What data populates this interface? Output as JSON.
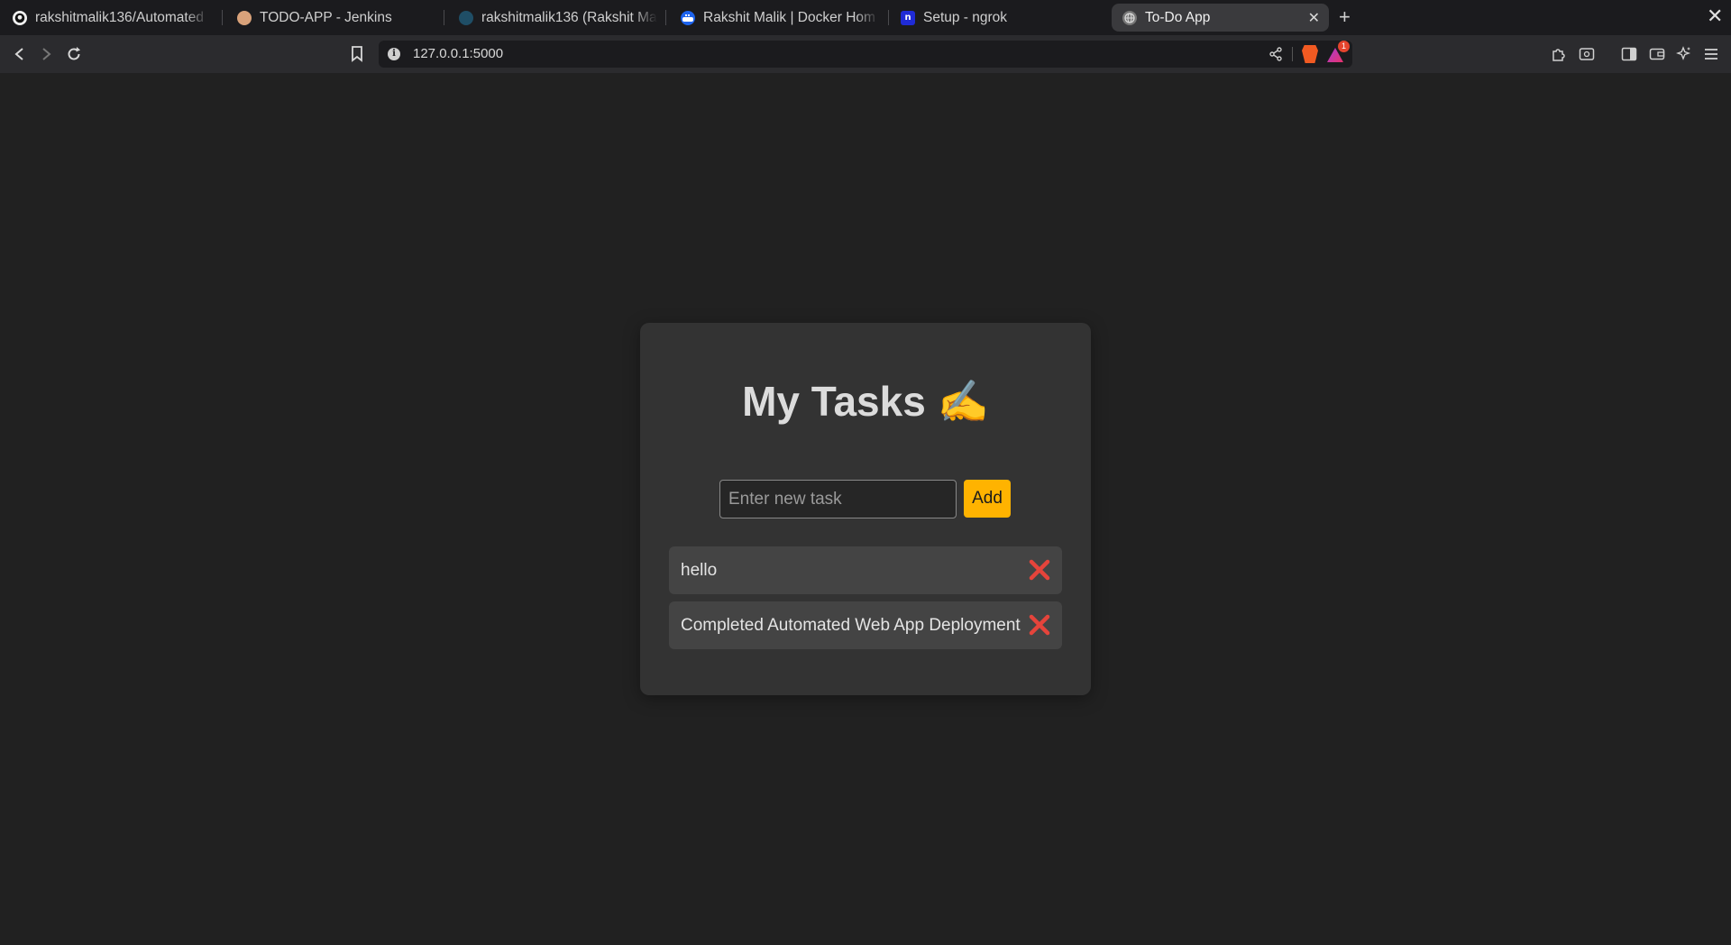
{
  "browser": {
    "tabs": [
      {
        "title": "rakshitmalik136/Automated",
        "icon": "github-icon",
        "active": false
      },
      {
        "title": "TODO-APP - Jenkins",
        "icon": "jenkins-icon",
        "active": false
      },
      {
        "title": "rakshitmalik136 (Rakshit Ma",
        "icon": "docker-hub-icon",
        "active": false
      },
      {
        "title": "Rakshit Malik | Docker Hom",
        "icon": "docker-icon",
        "active": false
      },
      {
        "title": "Setup - ngrok",
        "icon": "ngrok-icon",
        "active": false
      },
      {
        "title": "To-Do App",
        "icon": "globe-icon",
        "active": true
      }
    ],
    "close_tab_glyph": "✕",
    "new_tab_glyph": "+",
    "window_close_glyph": "✕",
    "address": "127.0.0.1:5000",
    "notification_count": "1",
    "accent_colors": {
      "brave": "#f15a22",
      "add_button": "#ffb300",
      "delete": "#e5443b"
    }
  },
  "app": {
    "title": "My Tasks ✍️",
    "input_placeholder": "Enter new task",
    "input_value": "",
    "add_label": "Add",
    "tasks": [
      {
        "text": "hello"
      },
      {
        "text": "Completed Automated Web App Deployment"
      }
    ]
  }
}
